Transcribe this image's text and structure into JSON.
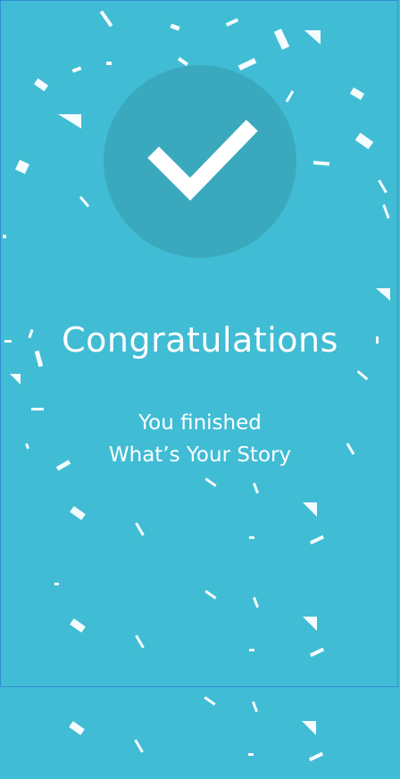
{
  "colors": {
    "background": "#41bcd5",
    "circle": "#3aa9be",
    "text": "#ffffff",
    "frame_border": "#2f8fd6"
  },
  "icons": {
    "success": "checkmark-icon",
    "decoration": "confetti"
  },
  "completion": {
    "title": "Congratulations",
    "subtitle_line1": "You finished",
    "subtitle_line2": "What’s Your Story"
  }
}
